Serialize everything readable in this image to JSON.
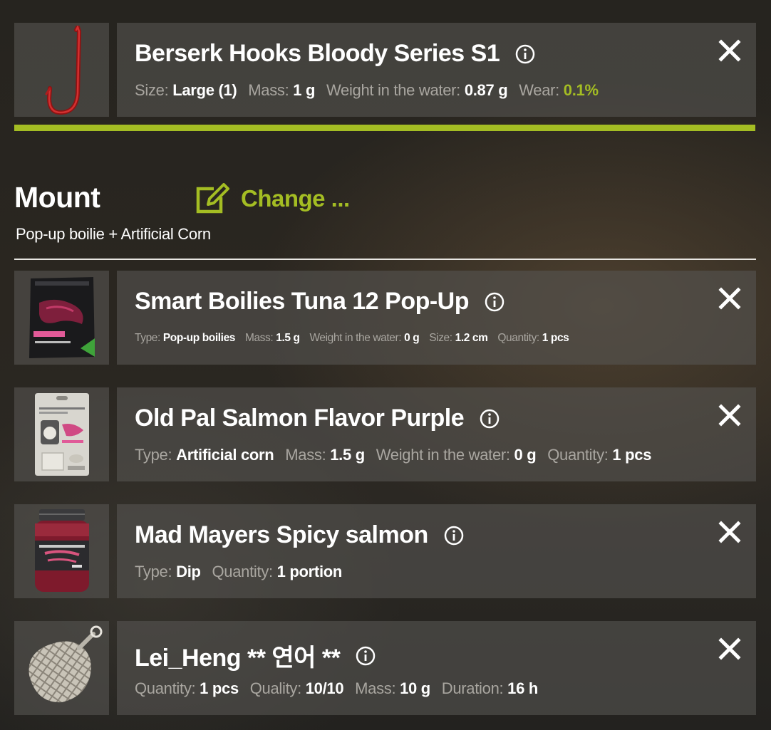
{
  "colors": {
    "accent": "#a4bd23",
    "label_gray": "#a9a6a0",
    "panel": "#56544f"
  },
  "hook": {
    "icon": "red-hook-icon",
    "title": "Berserk Hooks Bloody Series S1",
    "props": [
      {
        "label": "Size:",
        "value": "Large (1)"
      },
      {
        "label": "Mass:",
        "value": "1 g"
      },
      {
        "label": "Weight in the water:",
        "value": "0.87 g"
      },
      {
        "label": "Wear:",
        "value": "0.1%"
      }
    ]
  },
  "mount": {
    "title": "Mount",
    "change_label": "Change ...",
    "subtitle": "Pop-up boilie + Artificial Corn"
  },
  "items": [
    {
      "icon": "boilies-bag-icon",
      "title": "Smart Boilies Tuna 12 Pop-Up",
      "props": [
        {
          "label": "Type:",
          "value": "Pop-up boilies"
        },
        {
          "label": "Mass:",
          "value": "1.5 g"
        },
        {
          "label": "Weight in the water:",
          "value": "0 g"
        },
        {
          "label": "Size:",
          "value": "1.2 cm"
        },
        {
          "label": "Quantity:",
          "value": "1 pcs"
        }
      ]
    },
    {
      "icon": "corn-package-icon",
      "title": "Old Pal Salmon Flavor Purple",
      "props": [
        {
          "label": "Type:",
          "value": "Artificial corn"
        },
        {
          "label": "Mass:",
          "value": "1.5 g"
        },
        {
          "label": "Weight in the water:",
          "value": "0 g"
        },
        {
          "label": "Quantity:",
          "value": "1 pcs"
        }
      ]
    },
    {
      "icon": "dip-jar-icon",
      "title": "Mad Mayers Spicy salmon",
      "props": [
        {
          "label": "Type:",
          "value": "Dip"
        },
        {
          "label": "Quantity:",
          "value": "1 portion"
        }
      ]
    },
    {
      "icon": "pva-mesh-bag-icon",
      "title": "Lei_Heng ** 연어 **",
      "props": [
        {
          "label": "Quantity:",
          "value": "1 pcs"
        },
        {
          "label": "Quality:",
          "value": "10/10"
        },
        {
          "label": "Mass:",
          "value": "10 g"
        },
        {
          "label": "Duration:",
          "value": "16 h"
        }
      ]
    }
  ]
}
